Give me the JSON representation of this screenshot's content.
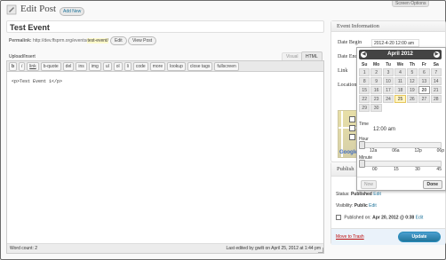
{
  "header": {
    "title": "Edit Post",
    "add_new": "Add New",
    "screen_options": "Screen Options"
  },
  "post": {
    "title": "Test Event",
    "permalink_label": "Permalink:",
    "permalink_url": "http://dev.ffsprm.org/events/",
    "permalink_slug": "test-event/",
    "edit_button": "Edit",
    "view_post_button": "View Post"
  },
  "editor": {
    "upload_insert": "Upload/Insert",
    "tab_visual": "Visual",
    "tab_html": "HTML",
    "quicktags": [
      "b",
      "i",
      "link",
      "b-quote",
      "del",
      "ins",
      "img",
      "ul",
      "ol",
      "li",
      "code",
      "more",
      "lookup",
      "close tags",
      "fullscreen"
    ],
    "content": "<p>Test Event 1</p>",
    "word_count": "Word count: 2",
    "last_edited": "Last edited by gwilt on April 25, 2012 at 1:44 pm"
  },
  "event_info": {
    "heading": "Event Information",
    "date_begin_label": "Date Begin",
    "date_begin_value": "2012-4-20 12:00 am",
    "date_end_label": "Date End",
    "link_label": "Link",
    "location_label": "Location",
    "map_logo": "Google"
  },
  "datepicker": {
    "month_label": "April 2012",
    "prev_icon": "◀",
    "next_icon": "▶",
    "weekdays": [
      "Su",
      "Mo",
      "Tu",
      "We",
      "Th",
      "Fr",
      "Sa"
    ],
    "weeks": [
      [
        "1",
        "2",
        "3",
        "4",
        "5",
        "6",
        "7"
      ],
      [
        "8",
        "9",
        "10",
        "11",
        "12",
        "13",
        "14"
      ],
      [
        "15",
        "16",
        "17",
        "18",
        "19",
        "20",
        "21"
      ],
      [
        "22",
        "23",
        "24",
        "25",
        "26",
        "27",
        "28"
      ],
      [
        "29",
        "30",
        "",
        "",
        "",
        "",
        ""
      ]
    ],
    "selected_day": "20",
    "today_day": "25",
    "time_label": "Time",
    "time_value": "12:00 am",
    "hour_label": "Hour",
    "hour_ticks": [
      "12a",
      "06a",
      "12p",
      "06p"
    ],
    "minute_label": "Minute",
    "minute_ticks": [
      "00",
      "15",
      "30",
      "45"
    ],
    "now_button": "Now",
    "done_button": "Done"
  },
  "publish": {
    "heading": "Publish",
    "status_label": "Status:",
    "status_value": "Published",
    "status_edit": "Edit",
    "visibility_label": "Visibility:",
    "visibility_value": "Public",
    "visibility_edit": "Edit",
    "published_label": "Published on:",
    "published_value": "Apr 20, 2012 @ 0:38",
    "published_edit": "Edit",
    "trash_link": "Move to Trash",
    "update_button": "Update"
  }
}
